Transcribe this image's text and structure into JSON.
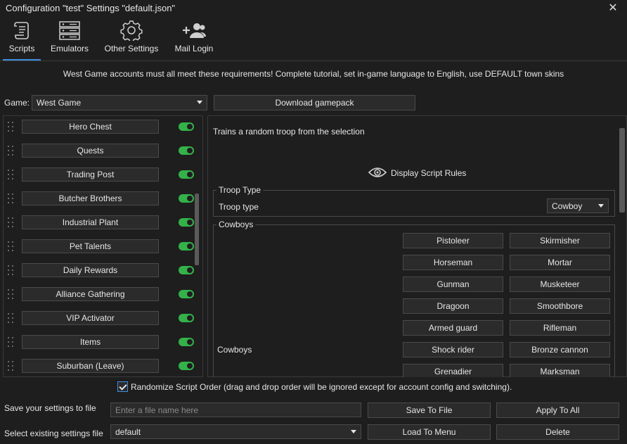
{
  "window": {
    "title": "Configuration \"test\" Settings \"default.json\"",
    "close_glyph": "✕"
  },
  "tabs": [
    {
      "label": "Scripts",
      "icon": "scroll-icon",
      "active": true
    },
    {
      "label": "Emulators",
      "icon": "server-icon",
      "active": false
    },
    {
      "label": "Other Settings",
      "icon": "gear-icon",
      "active": false
    },
    {
      "label": "Mail Login",
      "icon": "add-users-icon",
      "active": false
    }
  ],
  "notice": "West Game accounts must all meet these requirements! Complete tutorial, set in-game language to English, use DEFAULT town skins",
  "game": {
    "label": "Game:",
    "selected": "West Game",
    "download_label": "Download gamepack"
  },
  "scripts": [
    {
      "label": "Hero Chest",
      "enabled": true
    },
    {
      "label": "Quests",
      "enabled": true
    },
    {
      "label": "Trading Post",
      "enabled": true
    },
    {
      "label": "Butcher Brothers",
      "enabled": true
    },
    {
      "label": "Industrial Plant",
      "enabled": true
    },
    {
      "label": "Pet Talents",
      "enabled": true
    },
    {
      "label": "Daily Rewards",
      "enabled": true
    },
    {
      "label": "Alliance Gathering",
      "enabled": true
    },
    {
      "label": "VIP Activator",
      "enabled": true
    },
    {
      "label": "Items",
      "enabled": true
    },
    {
      "label": "Suburban (Leave)",
      "enabled": true
    }
  ],
  "detail": {
    "description": "Trains a random troop from the selection",
    "rules_label": "Display Script Rules",
    "troop_group_title": "Troop Type",
    "troop_label": "Troop type",
    "troop_selected": "Cowboy",
    "cowboy_group_title": "Cowboys",
    "cowboy_side_label": "Cowboys",
    "troops_left": [
      "Pistoleer",
      "Horseman",
      "Gunman",
      "Dragoon",
      "Armed guard",
      "Shock rider",
      "Grenadier"
    ],
    "troops_right": [
      "Skirmisher",
      "Mortar",
      "Musketeer",
      "Smoothbore",
      "Rifleman",
      "Bronze cannon",
      "Marksman"
    ]
  },
  "footer": {
    "randomize_checked": true,
    "randomize_label": "Randomize Script Order (drag and drop order will be ignored except for account config and switching).",
    "save_label": "Save your settings to file",
    "file_placeholder": "Enter a file name here",
    "save_to_file": "Save To File",
    "apply_to_all": "Apply To All",
    "select_label": "Select existing settings file",
    "selected_file": "default",
    "load_to_menu": "Load To Menu",
    "delete": "Delete"
  },
  "colors": {
    "background": "#1e1e1e",
    "button": "#2b2b2b",
    "border": "#4a4a4a",
    "accent": "#3d8fe0",
    "toggle_on": "#34b24a"
  }
}
